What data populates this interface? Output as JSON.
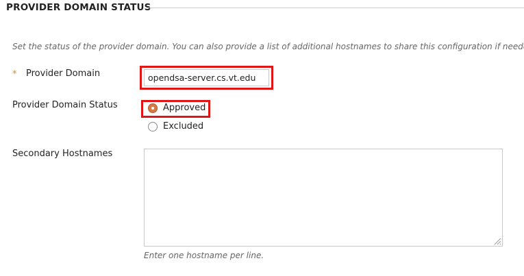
{
  "section": {
    "title": "PROVIDER DOMAIN STATUS",
    "description": "Set the status of the provider domain. You can also provide a list of additional hostnames to share this configuration if needed."
  },
  "provider_domain": {
    "required_marker": "*",
    "label": "Provider Domain",
    "value": "opendsa-server.cs.vt.edu"
  },
  "provider_domain_status": {
    "label": "Provider Domain Status",
    "options": [
      {
        "label": "Approved",
        "selected": true
      },
      {
        "label": "Excluded",
        "selected": false
      }
    ]
  },
  "secondary_hostnames": {
    "label": "Secondary Hostnames",
    "value": "",
    "help": "Enter one hostname per line."
  },
  "colors": {
    "highlight": "#e01616",
    "required": "#d08a2a",
    "radio_selected": "#d97a46"
  }
}
